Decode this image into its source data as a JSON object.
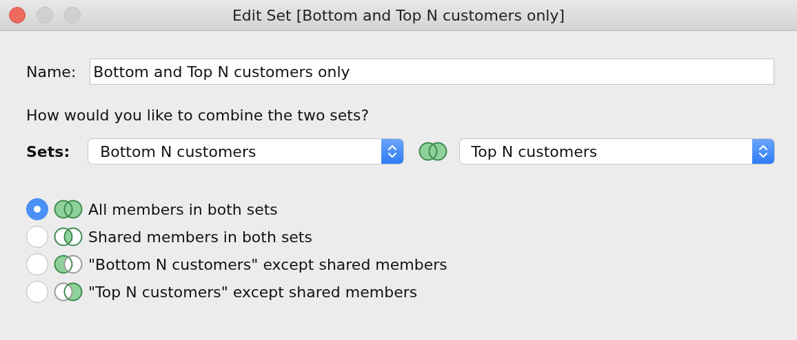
{
  "window": {
    "title": "Edit Set [Bottom and Top N customers only]"
  },
  "name_field": {
    "label": "Name:",
    "value": "Bottom and Top N customers only"
  },
  "question": "How would you like to combine the two sets?",
  "sets": {
    "label": "Sets:",
    "left": "Bottom N customers",
    "right": "Top N customers"
  },
  "options": [
    {
      "label": "All members in both sets",
      "kind": "union",
      "selected": true
    },
    {
      "label": "Shared members in both sets",
      "kind": "intersection",
      "selected": false
    },
    {
      "label": "\"Bottom N customers\" except shared members",
      "kind": "left",
      "selected": false
    },
    {
      "label": "\"Top N customers\" except shared members",
      "kind": "right",
      "selected": false
    }
  ]
}
